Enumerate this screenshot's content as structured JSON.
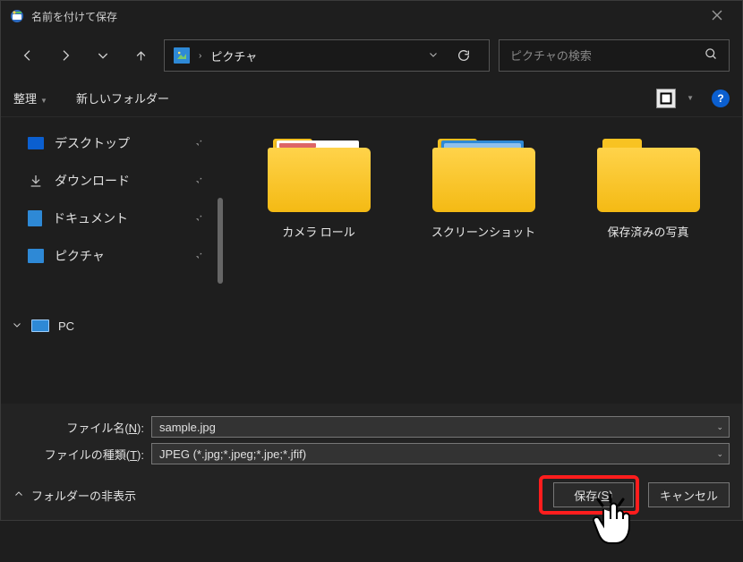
{
  "title": "名前を付けて保存",
  "path": {
    "location": "ピクチャ"
  },
  "search": {
    "placeholder": "ピクチャの検索"
  },
  "toolbar": {
    "organize": "整理",
    "new_folder": "新しいフォルダー"
  },
  "sidebar": {
    "items": [
      {
        "label": "デスクトップ"
      },
      {
        "label": "ダウンロード"
      },
      {
        "label": "ドキュメント"
      },
      {
        "label": "ピクチャ"
      }
    ],
    "pc_label": "PC"
  },
  "folders": [
    {
      "label": "カメラ ロール"
    },
    {
      "label": "スクリーンショット"
    },
    {
      "label": "保存済みの写真"
    }
  ],
  "fields": {
    "filename_label_pre": "ファイル名(",
    "filename_label_mnemonic": "N",
    "filename_label_post": "):",
    "filename_value": "sample.jpg",
    "filetype_label_pre": "ファイルの種類(",
    "filetype_label_mnemonic": "T",
    "filetype_label_post": "):",
    "filetype_value": "JPEG (*.jpg;*.jpeg;*.jpe;*.jfif)"
  },
  "bottom": {
    "hide_folders": "フォルダーの非表示",
    "save_pre": "保存(",
    "save_mnemonic": "S",
    "save_post": ")",
    "cancel": "キャンセル"
  }
}
